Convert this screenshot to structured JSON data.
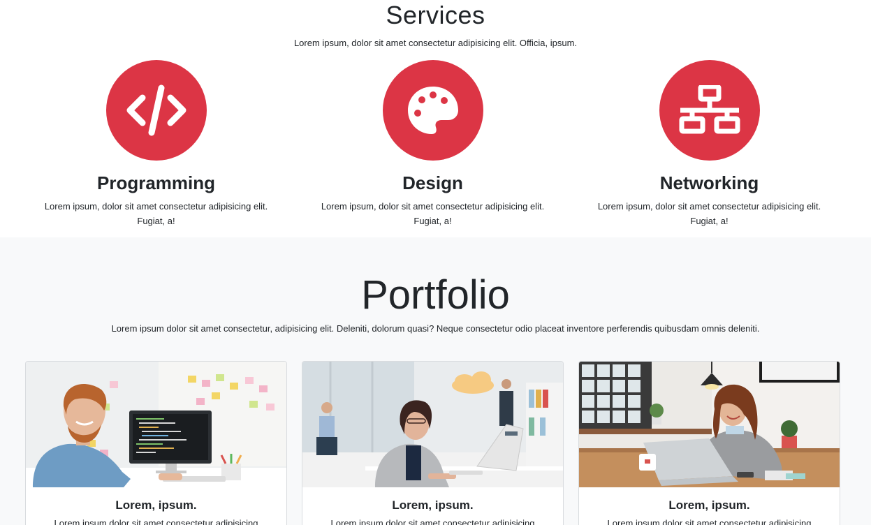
{
  "services": {
    "title": "Services",
    "subtitle": "Lorem ipsum, dolor sit amet consectetur adipisicing elit. Officia, ipsum.",
    "accent_color": "#dc3545",
    "items": [
      {
        "icon": "code-icon",
        "title": "Programming",
        "text": "Lorem ipsum, dolor sit amet consectetur adipisicing elit. Fugiat, a!"
      },
      {
        "icon": "palette-icon",
        "title": "Design",
        "text": "Lorem ipsum, dolor sit amet consectetur adipisicing elit. Fugiat, a!"
      },
      {
        "icon": "network-icon",
        "title": "Networking",
        "text": "Lorem ipsum, dolor sit amet consectetur adipisicing elit. Fugiat, a!"
      }
    ]
  },
  "portfolio": {
    "title": "Portfolio",
    "subtitle": "Lorem ipsum dolor sit amet consectetur, adipisicing elit. Deleniti, dolorum quasi? Neque consectetur odio placeat inventore perferendis quibusdam omnis deleniti.",
    "cards": [
      {
        "title": "Lorem, ipsum.",
        "text": "Lorem ipsum dolor sit amet consectetur adipisicing"
      },
      {
        "title": "Lorem, ipsum.",
        "text": "Lorem ipsum dolor sit amet consectetur adipisicing"
      },
      {
        "title": "Lorem, ipsum.",
        "text": "Lorem ipsum dolor sit amet consectetur adipisicing"
      }
    ]
  }
}
